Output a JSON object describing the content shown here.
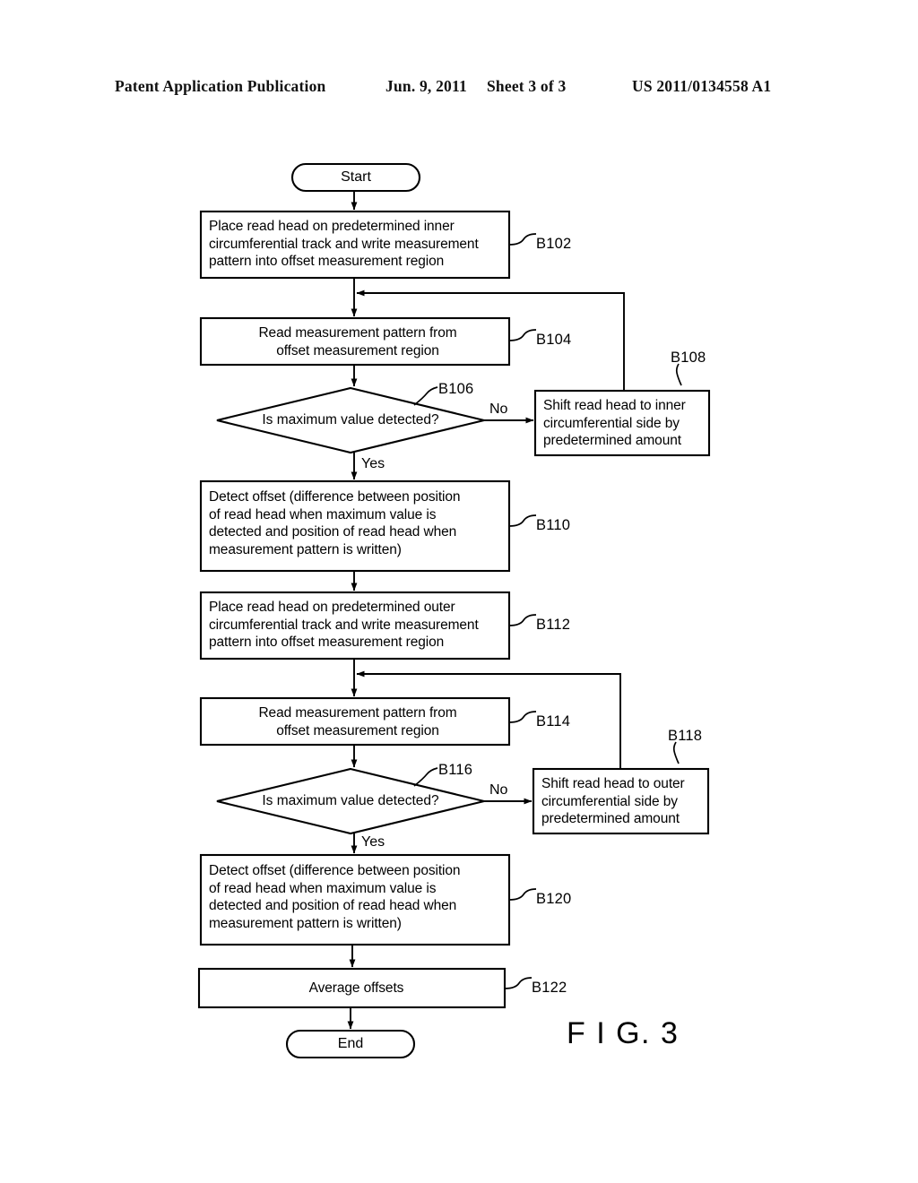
{
  "header": {
    "publication": "Patent Application Publication",
    "date": "Jun. 9, 2011",
    "sheet": "Sheet 3 of 3",
    "patent_number": "US 2011/0134558 A1"
  },
  "figure": {
    "caption": "F I G. 3",
    "terminals": {
      "start": "Start",
      "end": "End"
    },
    "branches": {
      "no_1": "No",
      "yes_1": "Yes",
      "no_2": "No",
      "yes_2": "Yes"
    },
    "nodes": [
      {
        "id": "B102",
        "ref": "B102",
        "text": "Place read head on predetermined inner\ncircumferential track and write measurement\npattern into offset measurement region"
      },
      {
        "id": "B104",
        "ref": "B104",
        "text": "Read measurement pattern from\noffset  measurement region"
      },
      {
        "id": "B106",
        "ref": "B106",
        "text": "Is maximum value detected?"
      },
      {
        "id": "B108",
        "ref": "B108",
        "text": "Shift read head to inner\ncircumferential side by\npredetermined amount"
      },
      {
        "id": "B110",
        "ref": "B110",
        "text": "Detect offset (difference between position\nof read head when maximum value is\ndetected and position of read head when\nmeasurement pattern is written)"
      },
      {
        "id": "B112",
        "ref": "B112",
        "text": "Place read head on predetermined outer\ncircumferential track and write measurement\npattern into offset measurement region"
      },
      {
        "id": "B114",
        "ref": "B114",
        "text": "Read measurement pattern from\noffset measurement region"
      },
      {
        "id": "B116",
        "ref": "B116",
        "text": "Is maximum value detected?"
      },
      {
        "id": "B118",
        "ref": "B118",
        "text": "Shift read head to outer\ncircumferential side by\npredetermined amount"
      },
      {
        "id": "B120",
        "ref": "B120",
        "text": "Detect offset (difference between position\nof read head when maximum value is\ndetected and position of read head when\nmeasurement pattern is written)"
      },
      {
        "id": "B122",
        "ref": "B122",
        "text": "Average offsets"
      }
    ]
  },
  "colors": {
    "ink": "#000000",
    "paper": "#ffffff"
  }
}
